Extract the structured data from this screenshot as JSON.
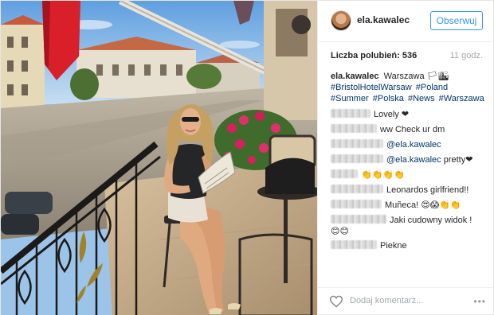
{
  "post": {
    "username": "ela.kawalec",
    "follow_label": "Obserwuj",
    "likes_text": "Liczba polubień: 536",
    "time_ago": "11 godz.",
    "caption": {
      "author": "ela.kawalec",
      "text": "Warszawa 🏳🏙",
      "hashtags": [
        "#BristolHotelWarsaw",
        "#Poland",
        "#Summer",
        "#Polska",
        "#News",
        "#Warszawa"
      ]
    },
    "comments": [
      {
        "text": "Lovely ❤"
      },
      {
        "text": "ww Check ur dm"
      },
      {
        "mention": "@ela.kawalec",
        "text": ""
      },
      {
        "mention": "@ela.kawalec",
        "text": " pretty❤"
      },
      {
        "text": "👏👏👏👏"
      },
      {
        "text": "Leonardos girlfriend!!"
      },
      {
        "text": "Muñeca! 😍😱👏👏"
      },
      {
        "text": "Jaki cudowny widok !"
      },
      {
        "text": "Piekne"
      }
    ],
    "trailing_emoji": "😊😊",
    "add_comment_placeholder": "Dodaj komentarz...",
    "more_label": "•••"
  },
  "icons": {
    "heart": "heart-icon",
    "more": "more-options-icon"
  },
  "colors": {
    "accent": "#3897f0",
    "hashtag": "#003569",
    "muted": "#a5a7aa"
  }
}
